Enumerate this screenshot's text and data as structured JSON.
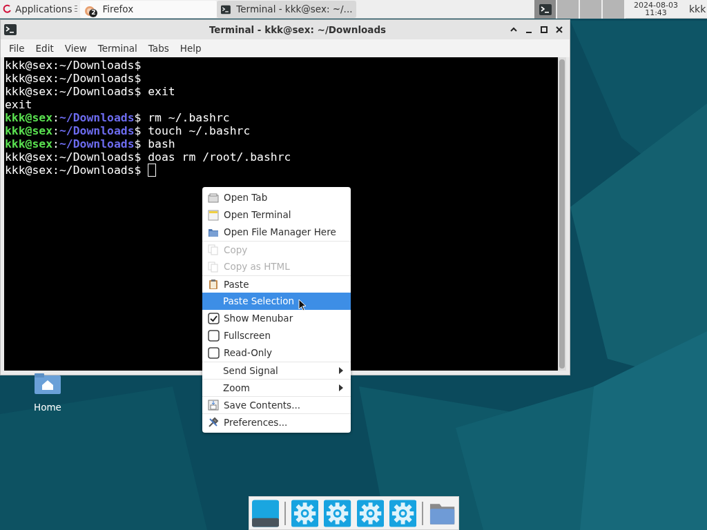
{
  "taskbar": {
    "applications": "Applications",
    "tasks": [
      {
        "label": "Firefox",
        "badge": "2",
        "selected": false
      },
      {
        "label": "Terminal - kkk@sex: ~/...",
        "selected": true
      }
    ],
    "workspaces": [
      {
        "selected": true
      },
      {
        "selected": false
      },
      {
        "selected": false
      },
      {
        "selected": false
      }
    ],
    "clock": {
      "date": "2024-08-03",
      "time": "11:43"
    },
    "user": "kkk"
  },
  "window": {
    "title": "Terminal - kkk@sex: ~/Downloads",
    "menu": [
      "File",
      "Edit",
      "View",
      "Terminal",
      "Tabs",
      "Help"
    ],
    "lines": [
      {
        "segments": [
          {
            "kind": "plain",
            "text": "kkk@sex:~/Downloads$"
          }
        ]
      },
      {
        "segments": [
          {
            "kind": "plain",
            "text": "kkk@sex:~/Downloads$"
          }
        ]
      },
      {
        "segments": [
          {
            "kind": "plain",
            "text": "kkk@sex:~/Downloads$ exit"
          }
        ]
      },
      {
        "segments": [
          {
            "kind": "plain",
            "text": "exit"
          }
        ]
      },
      {
        "segments": [
          {
            "kind": "user",
            "text": "kkk@sex"
          },
          {
            "kind": "plain",
            "text": ":"
          },
          {
            "kind": "path",
            "text": "~/Downloads"
          },
          {
            "kind": "plain",
            "text": "$ rm ~/.bashrc"
          }
        ]
      },
      {
        "segments": [
          {
            "kind": "user",
            "text": "kkk@sex"
          },
          {
            "kind": "plain",
            "text": ":"
          },
          {
            "kind": "path",
            "text": "~/Downloads"
          },
          {
            "kind": "plain",
            "text": "$ touch ~/.bashrc"
          }
        ]
      },
      {
        "segments": [
          {
            "kind": "user",
            "text": "kkk@sex"
          },
          {
            "kind": "plain",
            "text": ":"
          },
          {
            "kind": "path",
            "text": "~/Downloads"
          },
          {
            "kind": "plain",
            "text": "$ bash"
          }
        ]
      },
      {
        "segments": [
          {
            "kind": "plain",
            "text": "kkk@sex:~/Downloads$ doas rm /root/.bashrc"
          }
        ]
      },
      {
        "segments": [
          {
            "kind": "plain",
            "text": "kkk@sex:~/Downloads$ "
          }
        ],
        "cursor": true
      }
    ]
  },
  "context_menu": [
    {
      "kind": "action",
      "label": "Open Tab",
      "disabled": false,
      "selected": false,
      "separator_before": false
    },
    {
      "kind": "action",
      "label": "Open Terminal",
      "disabled": false,
      "selected": false,
      "separator_before": false
    },
    {
      "kind": "action",
      "label": "Open File Manager Here",
      "disabled": false,
      "selected": false,
      "separator_before": false
    },
    {
      "kind": "action",
      "label": "Copy",
      "disabled": true,
      "selected": false,
      "separator_before": true
    },
    {
      "kind": "action",
      "label": "Copy as HTML",
      "disabled": true,
      "selected": false,
      "separator_before": false
    },
    {
      "kind": "action",
      "label": "Paste",
      "disabled": false,
      "selected": false,
      "separator_before": true
    },
    {
      "kind": "action",
      "label": "Paste Selection",
      "disabled": false,
      "selected": true,
      "separator_before": false
    },
    {
      "kind": "check",
      "label": "Show Menubar",
      "checked": true,
      "disabled": false,
      "selected": false,
      "separator_before": false
    },
    {
      "kind": "check",
      "label": "Fullscreen",
      "checked": false,
      "disabled": false,
      "selected": false,
      "separator_before": false
    },
    {
      "kind": "check",
      "label": "Read-Only",
      "checked": false,
      "disabled": false,
      "selected": false,
      "separator_before": false
    },
    {
      "kind": "submenu",
      "label": "Send Signal",
      "disabled": false,
      "selected": false,
      "separator_before": true
    },
    {
      "kind": "submenu",
      "label": "Zoom",
      "disabled": false,
      "selected": false,
      "separator_before": true
    },
    {
      "kind": "action",
      "label": "Save Contents...",
      "disabled": false,
      "selected": false,
      "separator_before": true
    },
    {
      "kind": "action",
      "label": "Preferences...",
      "disabled": false,
      "selected": false,
      "separator_before": true
    }
  ],
  "desktop_icons": [
    {
      "label": "Home"
    }
  ]
}
